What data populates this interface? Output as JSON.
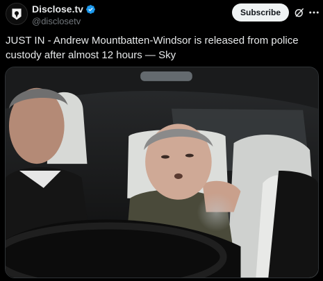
{
  "account": {
    "display_name": "Disclose.tv",
    "handle": "@disclosetv",
    "verified": true,
    "avatar_icon": "disclose-logo-icon"
  },
  "actions": {
    "subscribe_label": "Subscribe",
    "grok_icon": "grok-icon",
    "more_icon": "more-options-icon"
  },
  "post": {
    "text": "JUST IN - Andrew Mountbatten-Windsor is released from police custody after almost 12 hours — Sky"
  },
  "media": {
    "type": "photo",
    "icon": "photo-image"
  },
  "colors": {
    "background": "#000000",
    "text": "#e7e9ea",
    "secondary_text": "#71767b",
    "verified_blue": "#1d9bf0",
    "subscribe_bg": "#eff3f4",
    "subscribe_text": "#0f1419"
  }
}
